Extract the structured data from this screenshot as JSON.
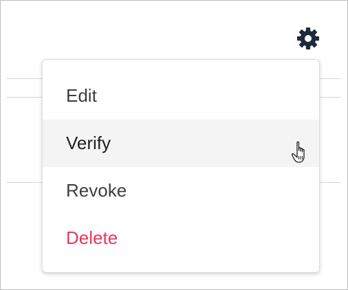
{
  "settings": {
    "icon": "gear-icon"
  },
  "menu": {
    "items": [
      {
        "label": "Edit",
        "state": "normal"
      },
      {
        "label": "Verify",
        "state": "hover"
      },
      {
        "label": "Revoke",
        "state": "normal"
      },
      {
        "label": "Delete",
        "state": "danger"
      }
    ]
  },
  "colors": {
    "danger": "#e8365a",
    "hover_bg": "#f4f4f4",
    "icon": "#1f2b3a"
  }
}
